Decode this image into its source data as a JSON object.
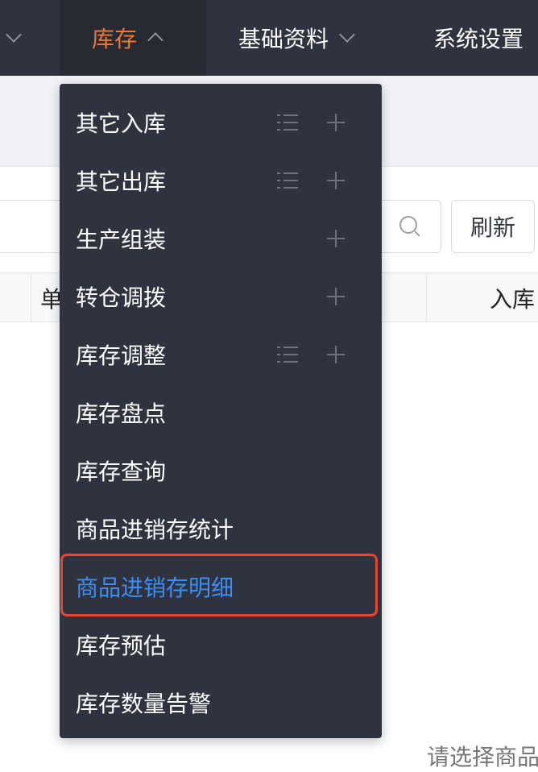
{
  "topnav": {
    "items": [
      {
        "label": ""
      },
      {
        "label": "库存"
      },
      {
        "label": "基础资料"
      },
      {
        "label": "系统设置"
      }
    ]
  },
  "toolbar": {
    "refresh_label": "刷新"
  },
  "table": {
    "headers": [
      "单",
      "入库"
    ]
  },
  "empty_hint": "请选择商品",
  "menu": {
    "items": [
      {
        "label": "其它入库",
        "list": true,
        "add": true
      },
      {
        "label": "其它出库",
        "list": true,
        "add": true
      },
      {
        "label": "生产组装",
        "list": false,
        "add": true
      },
      {
        "label": "转仓调拨",
        "list": false,
        "add": true
      },
      {
        "label": "库存调整",
        "list": true,
        "add": true
      },
      {
        "label": "库存盘点",
        "list": false,
        "add": false
      },
      {
        "label": "库存查询",
        "list": false,
        "add": false
      },
      {
        "label": "商品进销存统计",
        "list": false,
        "add": false
      },
      {
        "label": "商品进销存明细",
        "list": false,
        "add": false,
        "highlighted": true
      },
      {
        "label": "库存预估",
        "list": false,
        "add": false
      },
      {
        "label": "库存数量告警",
        "list": false,
        "add": false
      }
    ]
  },
  "colors": {
    "nav_bg": "#2f3340",
    "accent_orange": "#f0772e",
    "highlight_blue": "#3d8ef2",
    "annotation_red": "#e8452c"
  }
}
